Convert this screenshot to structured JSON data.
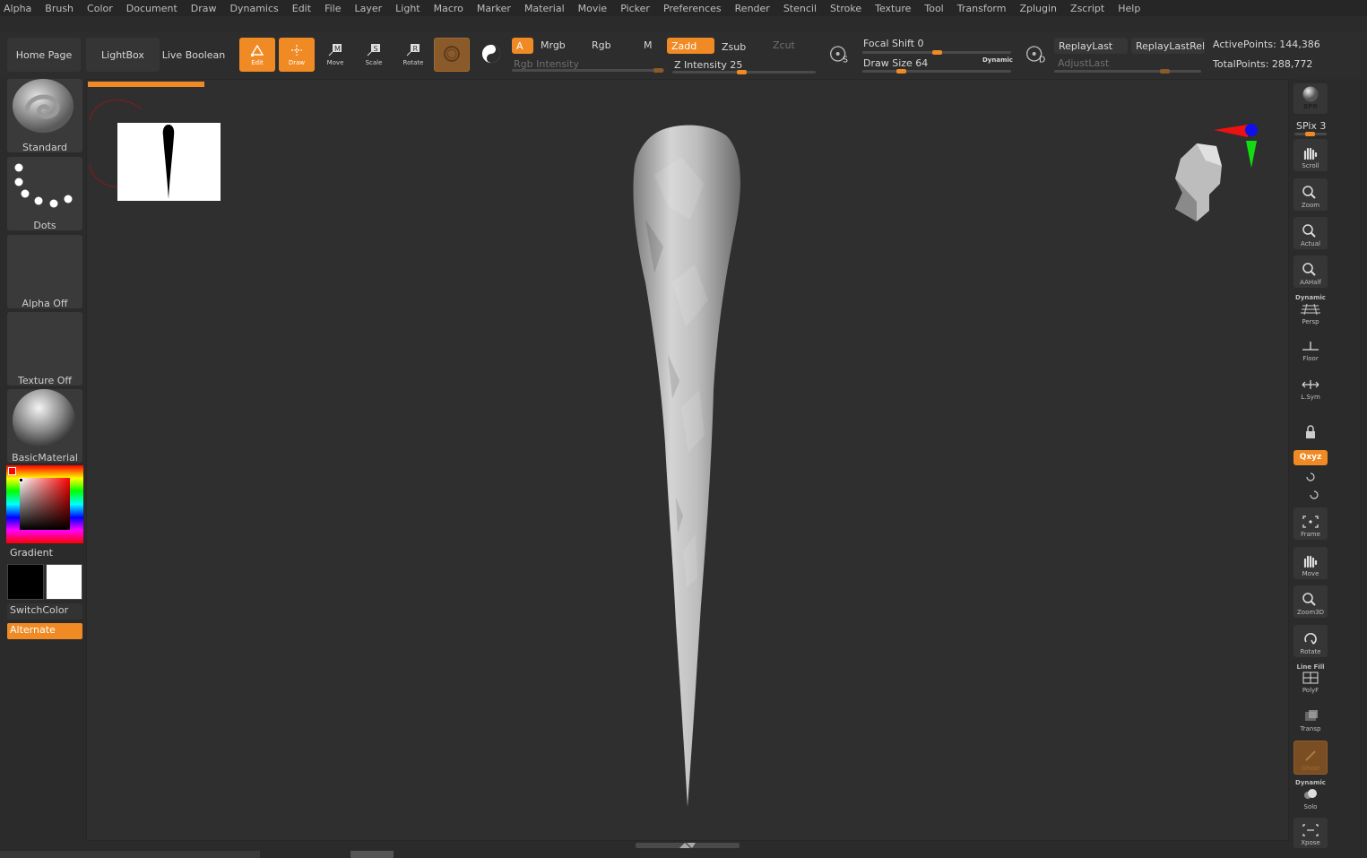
{
  "menu": [
    "Alpha",
    "Brush",
    "Color",
    "Document",
    "Draw",
    "Dynamics",
    "Edit",
    "File",
    "Layer",
    "Light",
    "Macro",
    "Marker",
    "Material",
    "Movie",
    "Picker",
    "Preferences",
    "Render",
    "Stencil",
    "Stroke",
    "Texture",
    "Tool",
    "Transform",
    "Zplugin",
    "Zscript",
    "Help"
  ],
  "nav": {
    "home": "Home Page",
    "lightbox": "LightBox",
    "live_boolean": "Live Boolean"
  },
  "tools": {
    "edit": "Edit",
    "draw": "Draw",
    "move": "Move",
    "scale": "Scale",
    "rotate": "Rotate"
  },
  "channels": {
    "a": "A",
    "mrgb": "Mrgb",
    "rgb": "Rgb",
    "m": "M",
    "zadd": "Zadd",
    "zsub": "Zsub",
    "zcut": "Zcut",
    "rgb_intensity": "Rgb Intensity",
    "z_intensity": "Z Intensity 25"
  },
  "draw": {
    "focal_shift": "Focal Shift 0",
    "draw_size": "Draw Size 64",
    "dynamic": "Dynamic",
    "s": "S",
    "d": "D"
  },
  "replay": {
    "last": "ReplayLast",
    "last_rel": "ReplayLastRel",
    "adjust_last": "AdjustLast"
  },
  "points": {
    "active": "ActivePoints: 144,386",
    "total": "TotalPoints: 288,772"
  },
  "left": {
    "brush": "Standard",
    "stroke": "Dots",
    "alpha": "Alpha Off",
    "texture": "Texture Off",
    "material": "BasicMaterial",
    "gradient": "Gradient",
    "switch_color": "SwitchColor",
    "alternate": "Alternate"
  },
  "right": {
    "bpr": "BPR",
    "spix": "SPix 3",
    "scroll": "Scroll",
    "zoom": "Zoom",
    "actual": "Actual",
    "aahalf": "AAHalf",
    "dynamic_persp": "Dynamic",
    "persp": "Persp",
    "floor": "Floor",
    "lsym": "L.Sym",
    "xyz": "Qxyz",
    "frame": "Frame",
    "move": "Move",
    "zoom3d": "Zoom3D",
    "rotate": "Rotate",
    "line_fill": "Line Fill",
    "polyf": "PolyF",
    "transp": "Transp",
    "ghost": "Ghost",
    "dynamic_solo": "Dynamic",
    "solo": "Solo",
    "xpose": "Xpose"
  },
  "colors": {
    "accent": "#f08a24",
    "background": "#2b2b2b",
    "canvas": "#2f2f2f",
    "main_color": "#000000",
    "secondary_color": "#ffffff"
  }
}
